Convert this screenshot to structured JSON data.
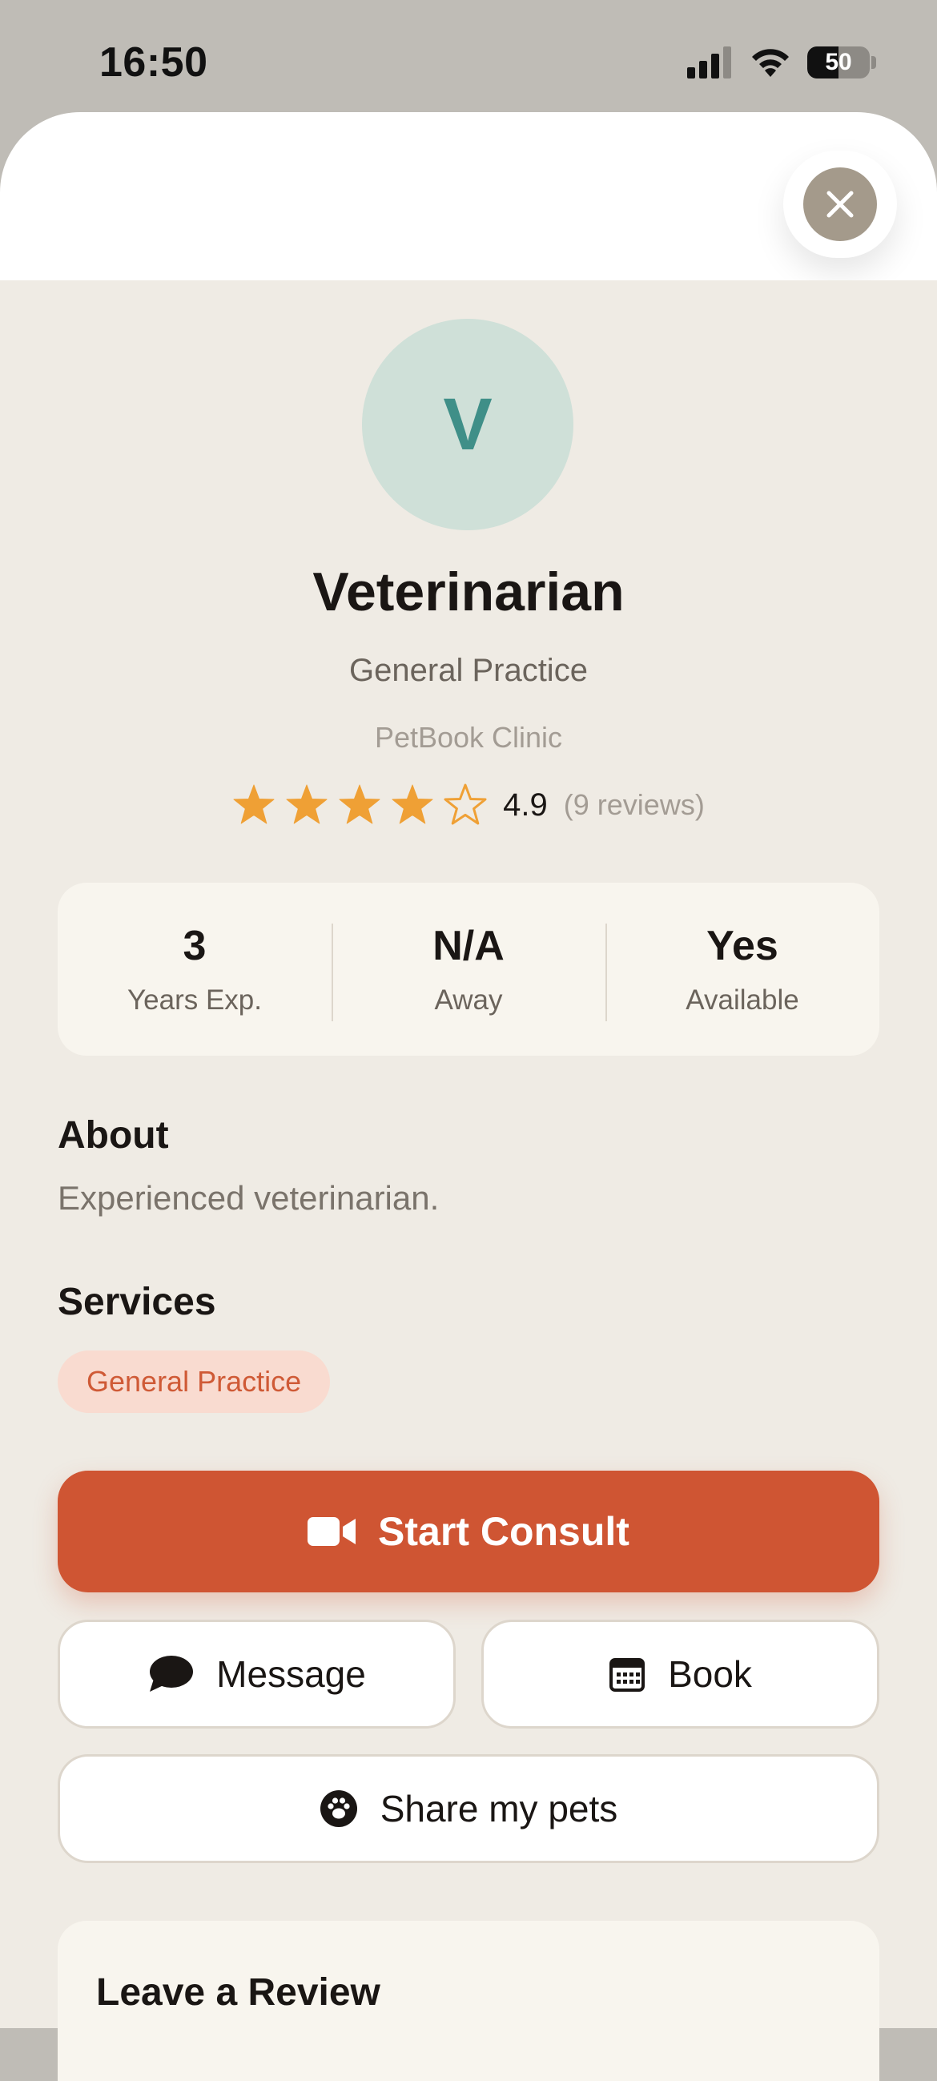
{
  "status_bar": {
    "time": "16:50",
    "battery": "50"
  },
  "profile": {
    "avatar_initial": "V",
    "name": "Veterinarian",
    "specialty": "General Practice",
    "clinic": "PetBook Clinic",
    "rating": {
      "stars_filled": 4,
      "stars_total": 5,
      "value": "4.9",
      "count": "(9 reviews)"
    }
  },
  "stats": [
    {
      "value": "3",
      "label": "Years Exp."
    },
    {
      "value": "N/A",
      "label": "Away"
    },
    {
      "value": "Yes",
      "label": "Available"
    }
  ],
  "about": {
    "title": "About",
    "text": "Experienced veterinarian."
  },
  "services": {
    "title": "Services",
    "items": [
      "General Practice"
    ]
  },
  "actions": {
    "start_consult": "Start Consult",
    "message": "Message",
    "book": "Book",
    "share_pets": "Share my pets"
  },
  "review": {
    "title": "Leave a Review"
  },
  "colors": {
    "accent": "#cf5533",
    "star": "#efa035",
    "avatar_bg": "#cfe0d8",
    "avatar_text": "#3f8f88",
    "background": "#efebe4"
  }
}
